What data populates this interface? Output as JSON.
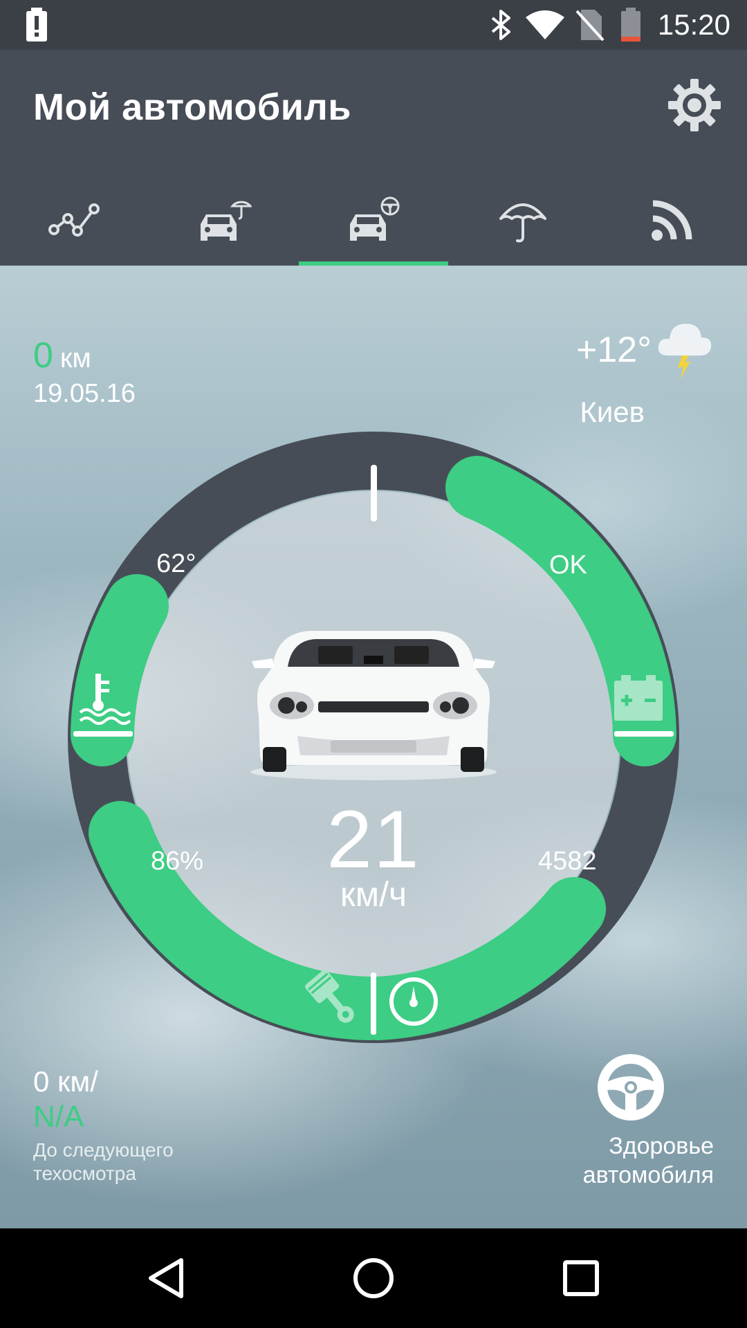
{
  "status_bar": {
    "time": "15:20",
    "icons": [
      "battery-alert-icon",
      "bluetooth-icon",
      "wifi-icon",
      "no-sim-icon",
      "battery-low-icon"
    ]
  },
  "app_bar": {
    "title": "Мой автомобиль",
    "settings_icon": "gear-icon",
    "tabs": [
      {
        "icon": "statistics-graph-icon"
      },
      {
        "icon": "car-insurance-icon"
      },
      {
        "icon": "car-steering-icon",
        "active": true
      },
      {
        "icon": "umbrella-icon"
      },
      {
        "icon": "rss-feed-icon"
      }
    ]
  },
  "trip": {
    "distance_value": "0",
    "distance_unit": "км",
    "date": "19.05.16"
  },
  "weather": {
    "temperature": "+12°",
    "city": "Киев",
    "icon": "thunderstorm-cloud-icon"
  },
  "gauge": {
    "coolant_temp": "62°",
    "battery_status": "OK",
    "fuel_level": "86%",
    "rpm": "4582",
    "speed": "21",
    "speed_unit": "км/ч"
  },
  "service": {
    "distance": "0 км/",
    "remaining": "N/A",
    "caption": "До следующего техосмотра"
  },
  "health": {
    "label": "Здоровье автомобиля",
    "icon": "steering-wheel-icon"
  },
  "colors": {
    "accent": "#3dcd84",
    "header": "#474d56",
    "statusbar": "#3b4047",
    "ring_dark": "#474d56"
  }
}
